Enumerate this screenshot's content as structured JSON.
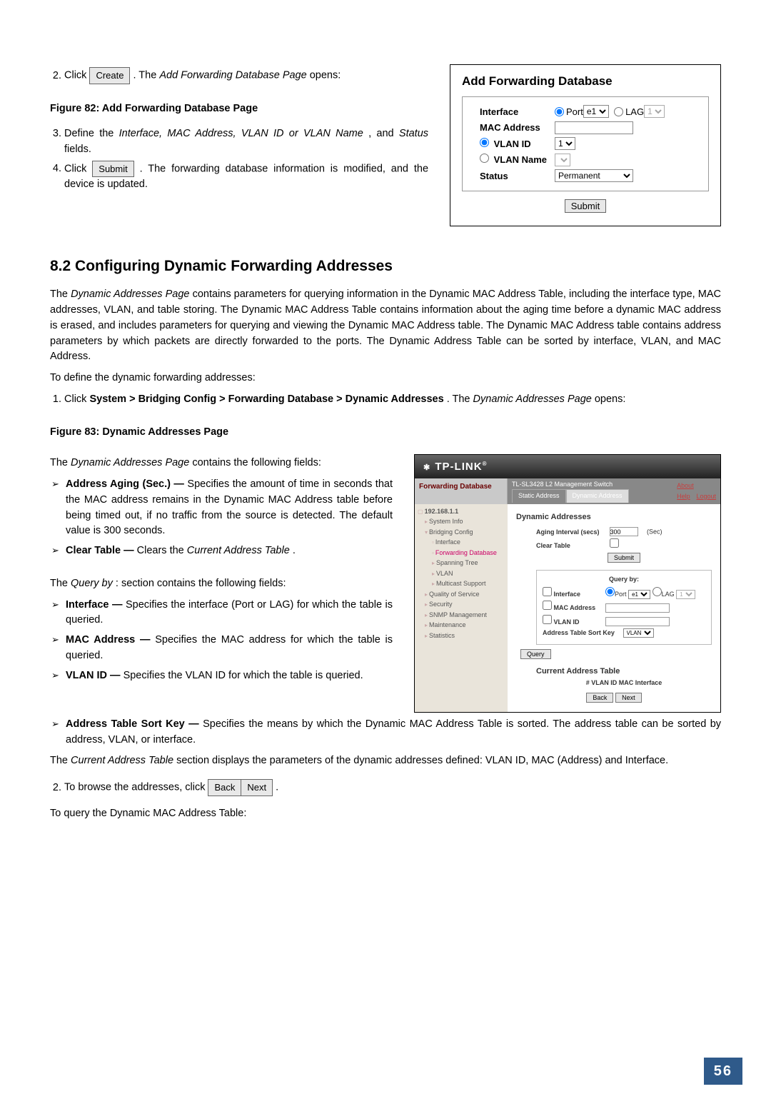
{
  "top": {
    "steps": [
      {
        "pre": "Click ",
        "btn": "Create",
        "post": ". The ",
        "ital": "Add Forwarding Database Page",
        "end": " opens:"
      }
    ],
    "fig82": "Figure 82: Add Forwarding Database Page",
    "step3": {
      "pre": "Define the ",
      "ital": "Interface, MAC Address, VLAN ID or VLAN Name",
      "mid": ", and ",
      "ital2": "Status",
      "end": " fields."
    },
    "step4": {
      "pre": "Click ",
      "btn": "Submit",
      "post": ". The forwarding database information is modified, and the device is updated."
    }
  },
  "addFwd": {
    "title": "Add Forwarding Database",
    "rows": {
      "interface": "Interface",
      "portLabel": "Port",
      "portSel": "e1",
      "lagLabel": "LAG",
      "lagSel": "1",
      "mac": "MAC Address",
      "vlanId": "VLAN ID",
      "vlanIdSel": "1",
      "vlanName": "VLAN Name",
      "status": "Status",
      "statusSel": "Permanent",
      "submit": "Submit"
    }
  },
  "section": {
    "num_title": "8.2   Configuring Dynamic Forwarding Addresses",
    "para1a": "The ",
    "para1ital": "Dynamic Addresses Page",
    "para1b": " contains parameters for querying information in the Dynamic MAC Address Table, including the interface type, MAC addresses, VLAN, and table storing. The Dynamic MAC Address Table contains information about the aging time before a dynamic MAC address is erased, and includes parameters for querying and viewing the Dynamic MAC Address table. The Dynamic MAC Address table contains address parameters by which packets are directly forwarded to the ports. The Dynamic Address Table can be sorted by interface, VLAN, and MAC Address.",
    "intro2": "To define the dynamic forwarding addresses:",
    "nav_pre": "Click ",
    "nav_bold": "System > Bridging Config > Forwarding Database > Dynamic Addresses",
    "nav_post": ". The ",
    "nav_ital": "Dynamic Addresses Page",
    "nav_end": " opens:",
    "fig83": "Figure 83: Dynamic Addresses Page"
  },
  "fields": {
    "intro_a": "The ",
    "intro_ital": "Dynamic Addresses Page",
    "intro_b": " contains the following fields:",
    "aging_bold": "Address Aging (Sec.) —",
    "aging_text": " Specifies the amount of time in seconds that the MAC address remains in the Dynamic MAC Address table before being timed out, if no traffic from the source is detected. The default value is 300 seconds.",
    "clear_bold": "Clear Table —",
    "clear_mid": " Clears the ",
    "clear_ital": "Current Address Table",
    "clear_end": "."
  },
  "query": {
    "intro_a": "The ",
    "intro_ital": "Query by",
    "intro_b": ": section contains the following fields:",
    "iface_bold": "Interface —",
    "iface_text": " Specifies the interface (Port or LAG) for which the table is queried.",
    "mac_bold": "MAC Address —",
    "mac_text": " Specifies the MAC address for which the table is queried.",
    "vlan_bold": "VLAN ID —",
    "vlan_text": " Specifies the VLAN ID for which the table is queried.",
    "sort_bold": "Address Table Sort Key —",
    "sort_text": "Specifies the means by which the Dynamic MAC Address Table is sorted. The address table can be sorted by address, VLAN, or interface."
  },
  "bottom": {
    "cat_a": "The ",
    "cat_ital": "Current Address Table",
    "cat_b": " section displays the parameters of the dynamic addresses defined: VLAN ID, MAC (Address) and Interface.",
    "browse_pre": "To browse the addresses, click ",
    "back": "Back",
    "next": "Next",
    "browse_post": ".",
    "last": "To query the Dynamic MAC Address Table:"
  },
  "dyn": {
    "brand": "TP-LINK",
    "hdrLeft": "Forwarding Database",
    "hdrTitle": "TL-SL3428 L2 Management Switch",
    "about": "About",
    "help": "Help",
    "logout": "Logout",
    "tabStatic": "Static Address",
    "tabDynamic": "Dynamic Address",
    "tree": {
      "root": "192.168.1.1",
      "items": [
        "System Info",
        "Bridging Config",
        "Interface",
        "Forwarding Database",
        "Spanning Tree",
        "VLAN",
        "Multicast Support",
        "Quality of Service",
        "Security",
        "SNMP Management",
        "Maintenance",
        "Statistics"
      ]
    },
    "main": {
      "title": "Dynamic Addresses",
      "agingLbl": "Aging Interval (secs)",
      "agingVal": "300",
      "sec": "(Sec)",
      "clearLbl": "Clear Table",
      "submit": "Submit",
      "queryBy": "Query by:",
      "ifaceLbl": "Interface",
      "portLabel": "Port",
      "portSel": "e1",
      "lagLabel": "LAG",
      "lagSel": "1",
      "macLbl": "MAC Address",
      "vlanLbl": "VLAN ID",
      "sortLbl": "Address Table Sort Key",
      "sortSel": "VLAN",
      "query": "Query",
      "catTitle": "Current Address Table",
      "tblHdr": "# VLAN ID MAC Interface",
      "back": "Back",
      "nextBtn": "Next"
    }
  },
  "pageNum": "56"
}
